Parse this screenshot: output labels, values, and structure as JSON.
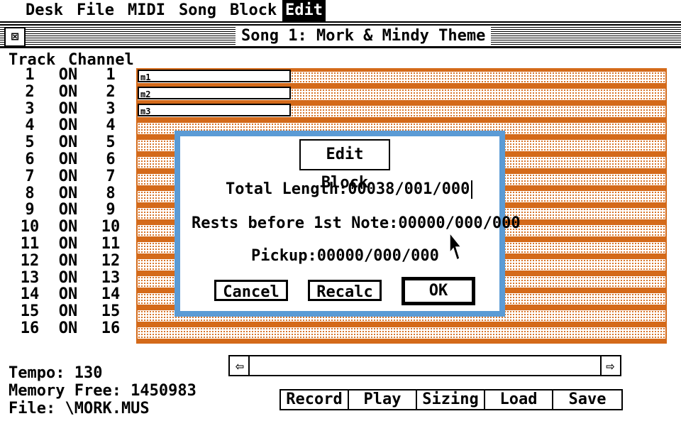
{
  "menu": [
    "Desk",
    "File",
    "MIDI",
    "Song",
    "Block",
    "Edit"
  ],
  "window": {
    "close_glyph": "⊠",
    "title": "Song 1: Mork & Mindy Theme"
  },
  "tracklist": {
    "header_track": "Track",
    "header_channel": "Channel",
    "rows": [
      {
        "track": "1",
        "state": "ON",
        "channel": "1"
      },
      {
        "track": "2",
        "state": "ON",
        "channel": "2"
      },
      {
        "track": "3",
        "state": "ON",
        "channel": "3"
      },
      {
        "track": "4",
        "state": "ON",
        "channel": "4"
      },
      {
        "track": "5",
        "state": "ON",
        "channel": "5"
      },
      {
        "track": "6",
        "state": "ON",
        "channel": "6"
      },
      {
        "track": "7",
        "state": "ON",
        "channel": "7"
      },
      {
        "track": "8",
        "state": "ON",
        "channel": "8"
      },
      {
        "track": "9",
        "state": "ON",
        "channel": "9"
      },
      {
        "track": "10",
        "state": "ON",
        "channel": "10"
      },
      {
        "track": "11",
        "state": "ON",
        "channel": "11"
      },
      {
        "track": "12",
        "state": "ON",
        "channel": "12"
      },
      {
        "track": "13",
        "state": "ON",
        "channel": "13"
      },
      {
        "track": "14",
        "state": "ON",
        "channel": "14"
      },
      {
        "track": "15",
        "state": "ON",
        "channel": "15"
      },
      {
        "track": "16",
        "state": "ON",
        "channel": "16"
      }
    ]
  },
  "blocks": [
    "m1",
    "m2",
    "m3"
  ],
  "dialog": {
    "title": "Edit Block",
    "total_length_label": "Total Length:",
    "total_length_value": "00038/001/000",
    "rests_label": "Rests before 1st Note:",
    "rests_value": "00000/000/000",
    "pickup_label": "Pickup:",
    "pickup_value": "00000/000/000",
    "cancel": "Cancel",
    "recalc": "Recalc",
    "ok": "OK"
  },
  "scroll": {
    "left_arrow": "⇦",
    "right_arrow": "⇨"
  },
  "transport": [
    "Record",
    "Play",
    "Sizing",
    "Load",
    "Save"
  ],
  "status": {
    "tempo": "Tempo: 130",
    "memory": "Memory Free: 1450983",
    "file": "File: \\MORK.MUS"
  },
  "colors": {
    "track_accent": "#d46a1a",
    "dialog_border": "#5b9bd5"
  }
}
